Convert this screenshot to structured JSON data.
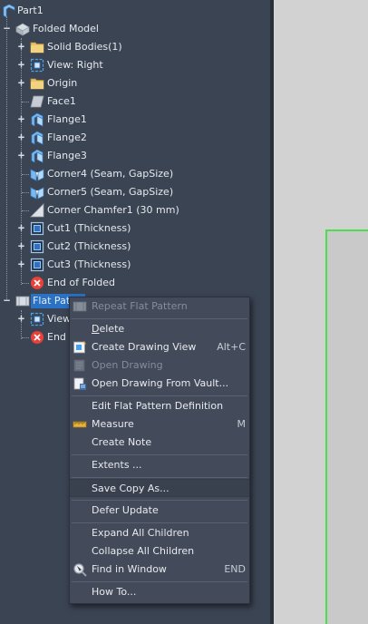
{
  "tree": {
    "root": "Part1",
    "folded_model": "Folded Model",
    "items": [
      {
        "label": "Solid Bodies(1)",
        "icon": "folder-icon"
      },
      {
        "label": "View: Right",
        "icon": "view-icon"
      },
      {
        "label": "Origin",
        "icon": "folder-icon"
      },
      {
        "label": "Face1",
        "icon": "face-icon"
      },
      {
        "label": "Flange1",
        "icon": "flange-icon"
      },
      {
        "label": "Flange2",
        "icon": "flange-icon"
      },
      {
        "label": "Flange3",
        "icon": "flange-icon"
      },
      {
        "label": "Corner4 (Seam, GapSize)",
        "icon": "corner-seam-icon"
      },
      {
        "label": "Corner5 (Seam, GapSize)",
        "icon": "corner-seam-icon"
      },
      {
        "label": "Corner Chamfer1 (30 mm)",
        "icon": "corner-chamfer-icon"
      },
      {
        "label": "Cut1 (Thickness)",
        "icon": "cut-icon"
      },
      {
        "label": "Cut2 (Thickness)",
        "icon": "cut-icon"
      },
      {
        "label": "Cut3 (Thickness)",
        "icon": "cut-icon"
      },
      {
        "label": "End of Folded",
        "icon": "end-of-part-icon"
      }
    ],
    "flat_pattern": "Flat Patt",
    "flat_children": [
      {
        "label": "View:",
        "icon": "view-icon"
      },
      {
        "label": "End o",
        "icon": "end-of-part-icon"
      }
    ]
  },
  "menu": {
    "items": [
      {
        "label": "Repeat Flat Pattern",
        "disabled": true,
        "icon": "flat-pattern-icon"
      },
      {
        "label": "Delete"
      },
      {
        "label": "Create Drawing View",
        "shortcut": "Alt+C",
        "icon": "drawing-view-icon"
      },
      {
        "label": "Open Drawing",
        "disabled": true,
        "icon": "open-drawing-icon"
      },
      {
        "label": "Open Drawing From Vault...",
        "icon": "vault-drawing-icon"
      },
      {
        "label": "Edit Flat Pattern Definition"
      },
      {
        "label": "Measure",
        "shortcut": "M",
        "icon": "measure-icon"
      },
      {
        "label": "Create Note"
      },
      {
        "label": "Extents ..."
      },
      {
        "label": "Save Copy As..."
      },
      {
        "label": "Defer Update"
      },
      {
        "label": "Expand All Children"
      },
      {
        "label": "Collapse All Children"
      },
      {
        "label": "Find in Window",
        "shortcut": "END",
        "icon": "find-in-window-icon"
      },
      {
        "label": "How To..."
      }
    ]
  },
  "colors": {
    "panel": "#3b4453",
    "selection": "#2a72c6",
    "menu_bg": "#434b5a",
    "canvas": "#d2d2d2",
    "sheet_edge": "#4fdc4f"
  }
}
